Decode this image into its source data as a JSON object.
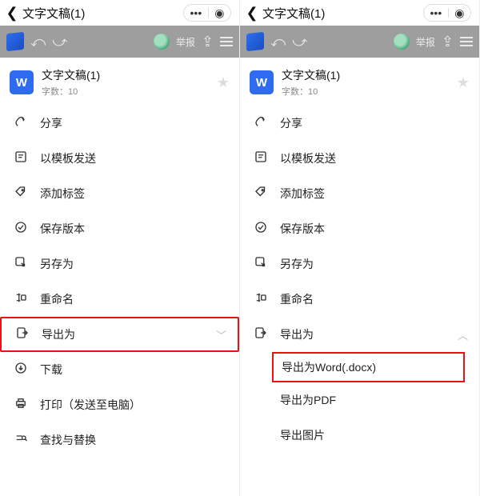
{
  "left": {
    "nav": {
      "title": "文字文稿(1)"
    },
    "greybar": {
      "report": "举报"
    },
    "doc": {
      "title": "文字文稿(1)",
      "sub": "字数：10"
    },
    "items": {
      "share": "分享",
      "sendTpl": "以模板发送",
      "addTag": "添加标签",
      "saveVer": "保存版本",
      "saveAs": "另存为",
      "rename": "重命名",
      "exportAs": "导出为",
      "download": "下载",
      "print": "打印（发送至电脑）",
      "findReplace": "查找与替换"
    }
  },
  "right": {
    "nav": {
      "title": "文字文稿(1)"
    },
    "greybar": {
      "report": "举报"
    },
    "doc": {
      "title": "文字文稿(1)",
      "sub": "字数：10"
    },
    "items": {
      "share": "分享",
      "sendTpl": "以模板发送",
      "addTag": "添加标签",
      "saveVer": "保存版本",
      "saveAs": "另存为",
      "rename": "重命名",
      "exportAs": "导出为"
    },
    "subs": {
      "word": "导出为Word(.docx)",
      "pdf": "导出为PDF",
      "img": "导出图片"
    }
  }
}
